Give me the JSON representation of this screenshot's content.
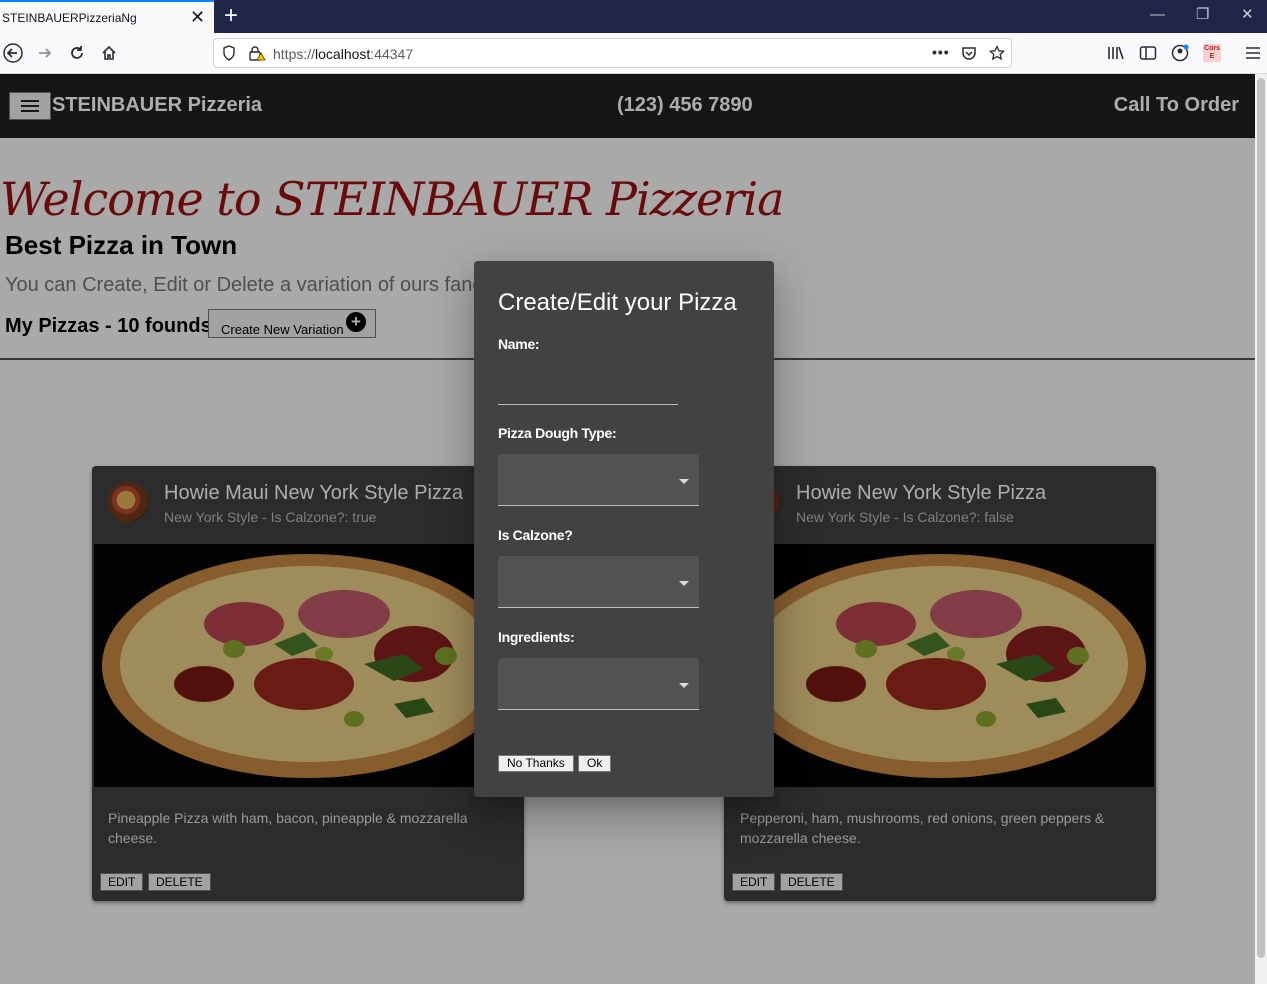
{
  "browser": {
    "tab_title": "STEINBAUERPizzeriaNg",
    "tab_close": "✕",
    "new_tab": "+",
    "url_prefix": "https://",
    "url_host": "localhost",
    "url_port": ":44347",
    "win_min": "—",
    "win_restore": "❐",
    "win_close": "✕",
    "page_actions": "•••",
    "cors_badge": "Cors E"
  },
  "toolbar": {
    "brand": "STEINBAUER Pizzeria",
    "phone": "(123) 456 7890",
    "call": "Call To Order"
  },
  "hero": {
    "welcome": "Welcome to STEINBAUER Pizzeria",
    "best": "Best Pizza in Town",
    "subtitle": "You can Create, Edit or Delete a variation of ours fanc",
    "my_pizzas": "My Pizzas - 10 founds",
    "create_button": "Create New Variation"
  },
  "cards": [
    {
      "title": "Howie Maui New York Style Pizza",
      "subtitle": "New York Style - Is Calzone?: true",
      "description": "Pineapple Pizza with ham, bacon, pineapple & mozzarella cheese.",
      "edit": "EDIT",
      "delete": "DELETE"
    },
    {
      "title": "Howie New York Style Pizza",
      "subtitle": "New York Style - Is Calzone?: false",
      "description": "Pepperoni, ham, mushrooms, red onions, green peppers & mozzarella cheese.",
      "edit": "EDIT",
      "delete": "DELETE"
    }
  ],
  "dialog": {
    "title": "Create/Edit your Pizza",
    "name_label": "Name:",
    "name_value": "",
    "dough_label": "Pizza Dough Type:",
    "calzone_label": "Is Calzone?",
    "ingredients_label": "Ingredients:",
    "no_thanks": "No Thanks",
    "ok": "Ok"
  },
  "colors": {
    "toolbar_bg": "#212121",
    "accent_title": "#9b1111",
    "card_bg": "#424242",
    "tab_accent": "#0a84ff"
  }
}
